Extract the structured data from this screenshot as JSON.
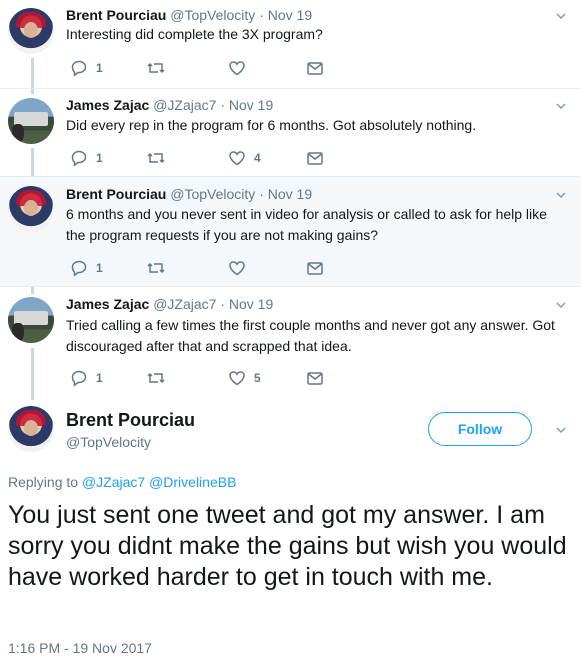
{
  "tweets": [
    {
      "name": "Brent Pourciau",
      "handle": "@TopVelocity",
      "date": "Nov 19",
      "text": "Interesting did complete the 3X program?",
      "replies": "1",
      "retweets": "",
      "likes": ""
    },
    {
      "name": "James Zajac",
      "handle": "@JZajac7",
      "date": "Nov 19",
      "text": "Did every rep in the program for 6 months. Got absolutely nothing.",
      "replies": "1",
      "retweets": "",
      "likes": "4"
    },
    {
      "name": "Brent Pourciau",
      "handle": "@TopVelocity",
      "date": "Nov 19",
      "text": "6 months and you never sent in video for analysis or called to ask for help like the program requests if you are not making gains?",
      "replies": "1",
      "retweets": "",
      "likes": ""
    },
    {
      "name": "James Zajac",
      "handle": "@JZajac7",
      "date": "Nov 19",
      "text": "Tried calling a few times the first couple months and never got any answer. Got discouraged after that and scrapped that idea.",
      "replies": "1",
      "retweets": "",
      "likes": "5"
    }
  ],
  "main": {
    "name": "Brent Pourciau",
    "handle": "@TopVelocity",
    "follow_label": "Follow",
    "replying_prefix": "Replying to",
    "replying_to_1": "@JZajac7",
    "replying_to_2": "@DrivelineBB",
    "text": "You just sent one tweet and got my answer. I am sorry you didnt make the gains but wish you would have worked harder to get in touch with me.",
    "timestamp": "1:16 PM - 19 Nov 2017"
  },
  "separator": "·",
  "colors": {
    "accent": "#1da1f2",
    "muted": "#657786",
    "highlight_bg": "#f5f8fa",
    "thread_line": "#ccd6dd"
  },
  "icons": [
    "reply-icon",
    "retweet-icon",
    "like-icon",
    "message-icon",
    "chevron-down-icon"
  ]
}
